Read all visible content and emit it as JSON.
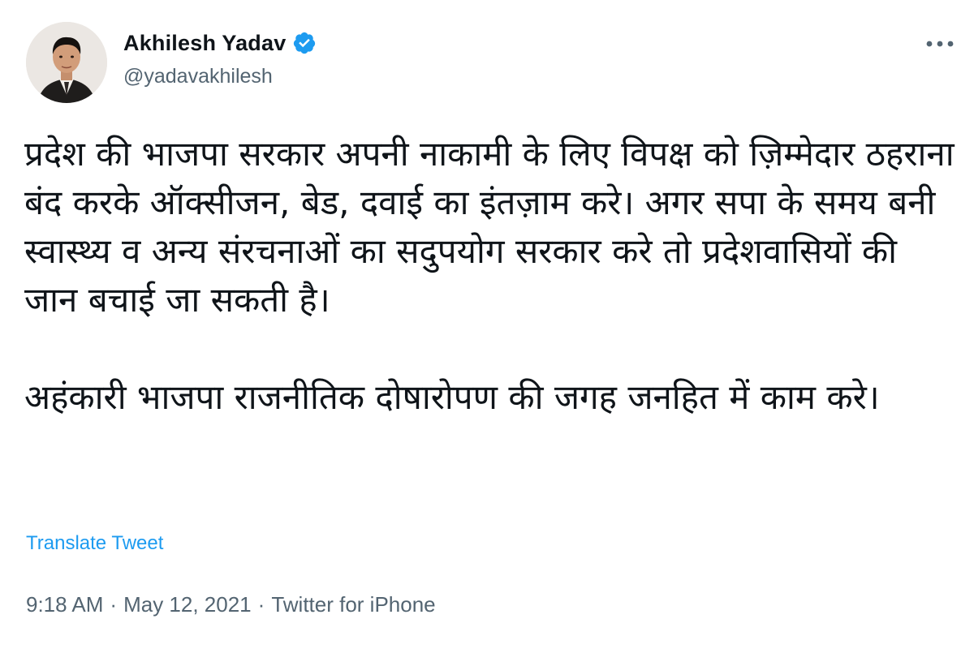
{
  "author": {
    "display_name": "Akhilesh Yadav",
    "handle": "@yadavakhilesh",
    "verified": true,
    "avatar_icon": "profile-photo"
  },
  "tweet": {
    "paragraphs": [
      "प्रदेश की भाजपा सरकार अपनी नाकामी के लिए विपक्ष को ज़िम्मेदार ठहराना बंद करके ऑक्सीजन, बेड, दवाई का इंतज़ाम करे। अगर सपा के समय बनी स्वास्थ्य व अन्य संरचनाओं का सदुपयोग सरकार करे तो प्रदेशवासियों की जान बचाई जा सकती है।",
      "अहंकारी भाजपा राजनीतिक दोषारोपण की जगह जनहित में काम करे।"
    ],
    "translate_label": "Translate Tweet",
    "time": "9:18 AM",
    "separator": "·",
    "date": "May 12, 2021",
    "source": "Twitter for iPhone"
  },
  "colors": {
    "link": "#1d9bf0",
    "verified": "#1d9bf0",
    "secondary_text": "#536471",
    "primary_text": "#0f1419"
  },
  "icons": {
    "verified": "verified-badge-icon",
    "more": "more-options-icon"
  }
}
